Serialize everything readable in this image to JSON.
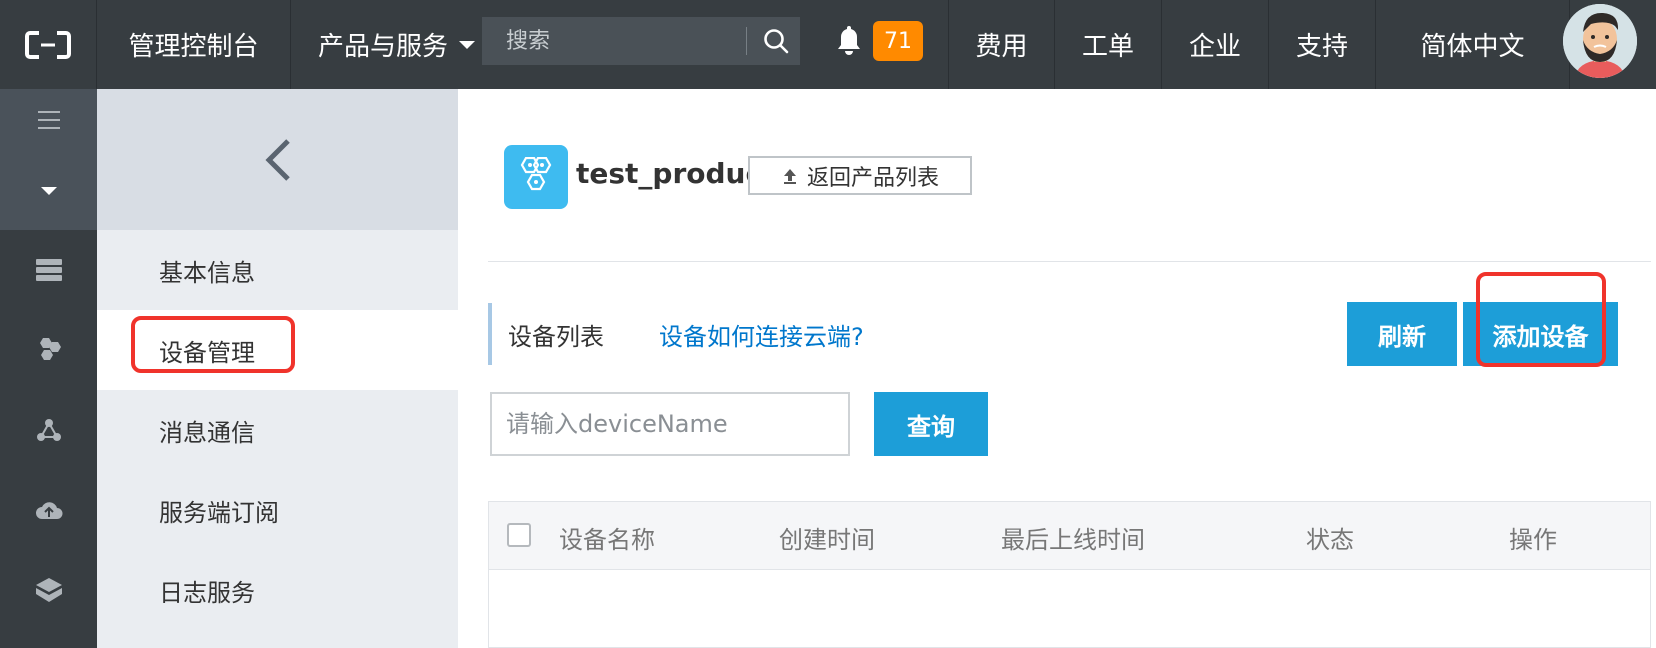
{
  "topbar": {
    "console_label": "管理控制台",
    "products_label": "产品与服务",
    "search_placeholder": "搜索",
    "notification_count": "71",
    "nav": [
      "费用",
      "工单",
      "企业",
      "支持",
      "简体中文"
    ]
  },
  "sidebar": {
    "items": [
      {
        "label": "基本信息"
      },
      {
        "label": "设备管理"
      },
      {
        "label": "消息通信"
      },
      {
        "label": "服务端订阅"
      },
      {
        "label": "日志服务"
      }
    ]
  },
  "main": {
    "product_name": "test_product",
    "back_label": "返回产品列表",
    "list_title": "设备列表",
    "help_link": "设备如何连接云端?",
    "refresh_label": "刷新",
    "add_device_label": "添加设备",
    "query_placeholder": "请输入deviceName",
    "query_label": "查询",
    "table": {
      "columns": [
        "设备名称",
        "创建时间",
        "最后上线时间",
        "状态",
        "操作"
      ]
    }
  },
  "colors": {
    "topbar_bg": "#373d41",
    "primary": "#1d9ed8",
    "badge": "#ff8a00",
    "highlight": "#f0332b",
    "link": "#0077cc"
  }
}
